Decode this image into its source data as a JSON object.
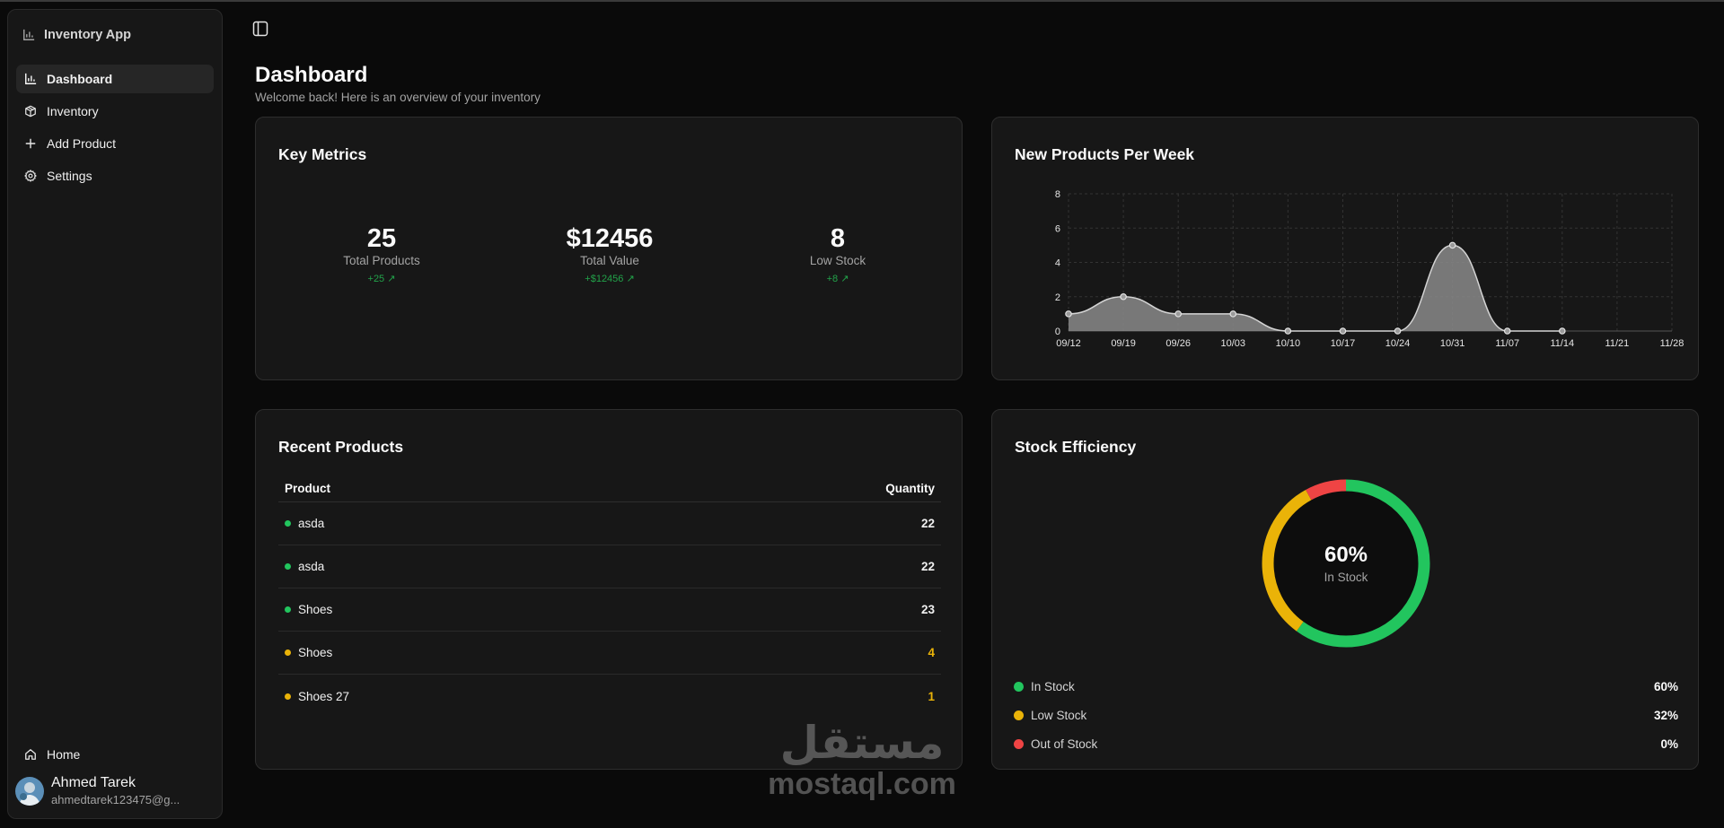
{
  "app": {
    "name": "Inventory App"
  },
  "sidebar": {
    "items": [
      {
        "label": "Dashboard",
        "icon": "bar-chart-icon",
        "active": true
      },
      {
        "label": "Inventory",
        "icon": "package-icon",
        "active": false
      },
      {
        "label": "Add Product",
        "icon": "plus-icon",
        "active": false
      },
      {
        "label": "Settings",
        "icon": "gear-icon",
        "active": false
      }
    ],
    "home_label": "Home",
    "user": {
      "name": "Ahmed Tarek",
      "email": "ahmedtarek123475@g..."
    }
  },
  "header": {
    "title": "Dashboard",
    "subtitle": "Welcome back! Here is an overview of your inventory"
  },
  "metrics": {
    "title": "Key Metrics",
    "items": [
      {
        "value": "25",
        "label": "Total Products",
        "change": "+25"
      },
      {
        "value": "$12456",
        "label": "Total Value",
        "change": "+$12456"
      },
      {
        "value": "8",
        "label": "Low Stock",
        "change": "+8"
      }
    ],
    "positive_color": "#22a34a"
  },
  "chart": {
    "title": "New Products Per Week",
    "chart_data": {
      "type": "area",
      "title": "New Products Per Week",
      "x": [
        "09/12",
        "09/19",
        "09/26",
        "10/03",
        "10/10",
        "10/17",
        "10/24",
        "10/31",
        "11/07",
        "11/14",
        "11/21",
        "11/28"
      ],
      "values": [
        1,
        2,
        1,
        1,
        0,
        0,
        0,
        5,
        0,
        0
      ],
      "ytick_labels": [
        "0",
        "2",
        "4",
        "6",
        "8"
      ],
      "ylim": [
        0,
        8
      ],
      "grid": true,
      "xlabel": "",
      "ylabel": ""
    }
  },
  "recent": {
    "title": "Recent Products",
    "col_product": "Product",
    "col_quantity": "Quantity",
    "rows": [
      {
        "name": "asda",
        "qty": "22",
        "status": "in-stock"
      },
      {
        "name": "asda",
        "qty": "22",
        "status": "in-stock"
      },
      {
        "name": "Shoes",
        "qty": "23",
        "status": "in-stock"
      },
      {
        "name": "Shoes",
        "qty": "4",
        "status": "low-stock"
      },
      {
        "name": "Shoes 27",
        "qty": "1",
        "status": "low-stock"
      }
    ]
  },
  "efficiency": {
    "title": "Stock Efficiency",
    "center_value": "60%",
    "center_label": "In Stock",
    "segments": [
      {
        "label": "In Stock",
        "value": "60%",
        "fraction": 0.6,
        "color": "#22c55e"
      },
      {
        "label": "Low Stock",
        "value": "32%",
        "fraction": 0.32,
        "color": "#eab308"
      },
      {
        "label": "Out of Stock",
        "value": "0%",
        "fraction": 0.08,
        "color": "#ef4444"
      }
    ]
  },
  "colors": {
    "in_stock": "#22c55e",
    "low_stock": "#eab308",
    "out_of_stock": "#ef4444"
  },
  "watermark": {
    "arabic": "مستقل",
    "latin": "mostaql.com"
  }
}
